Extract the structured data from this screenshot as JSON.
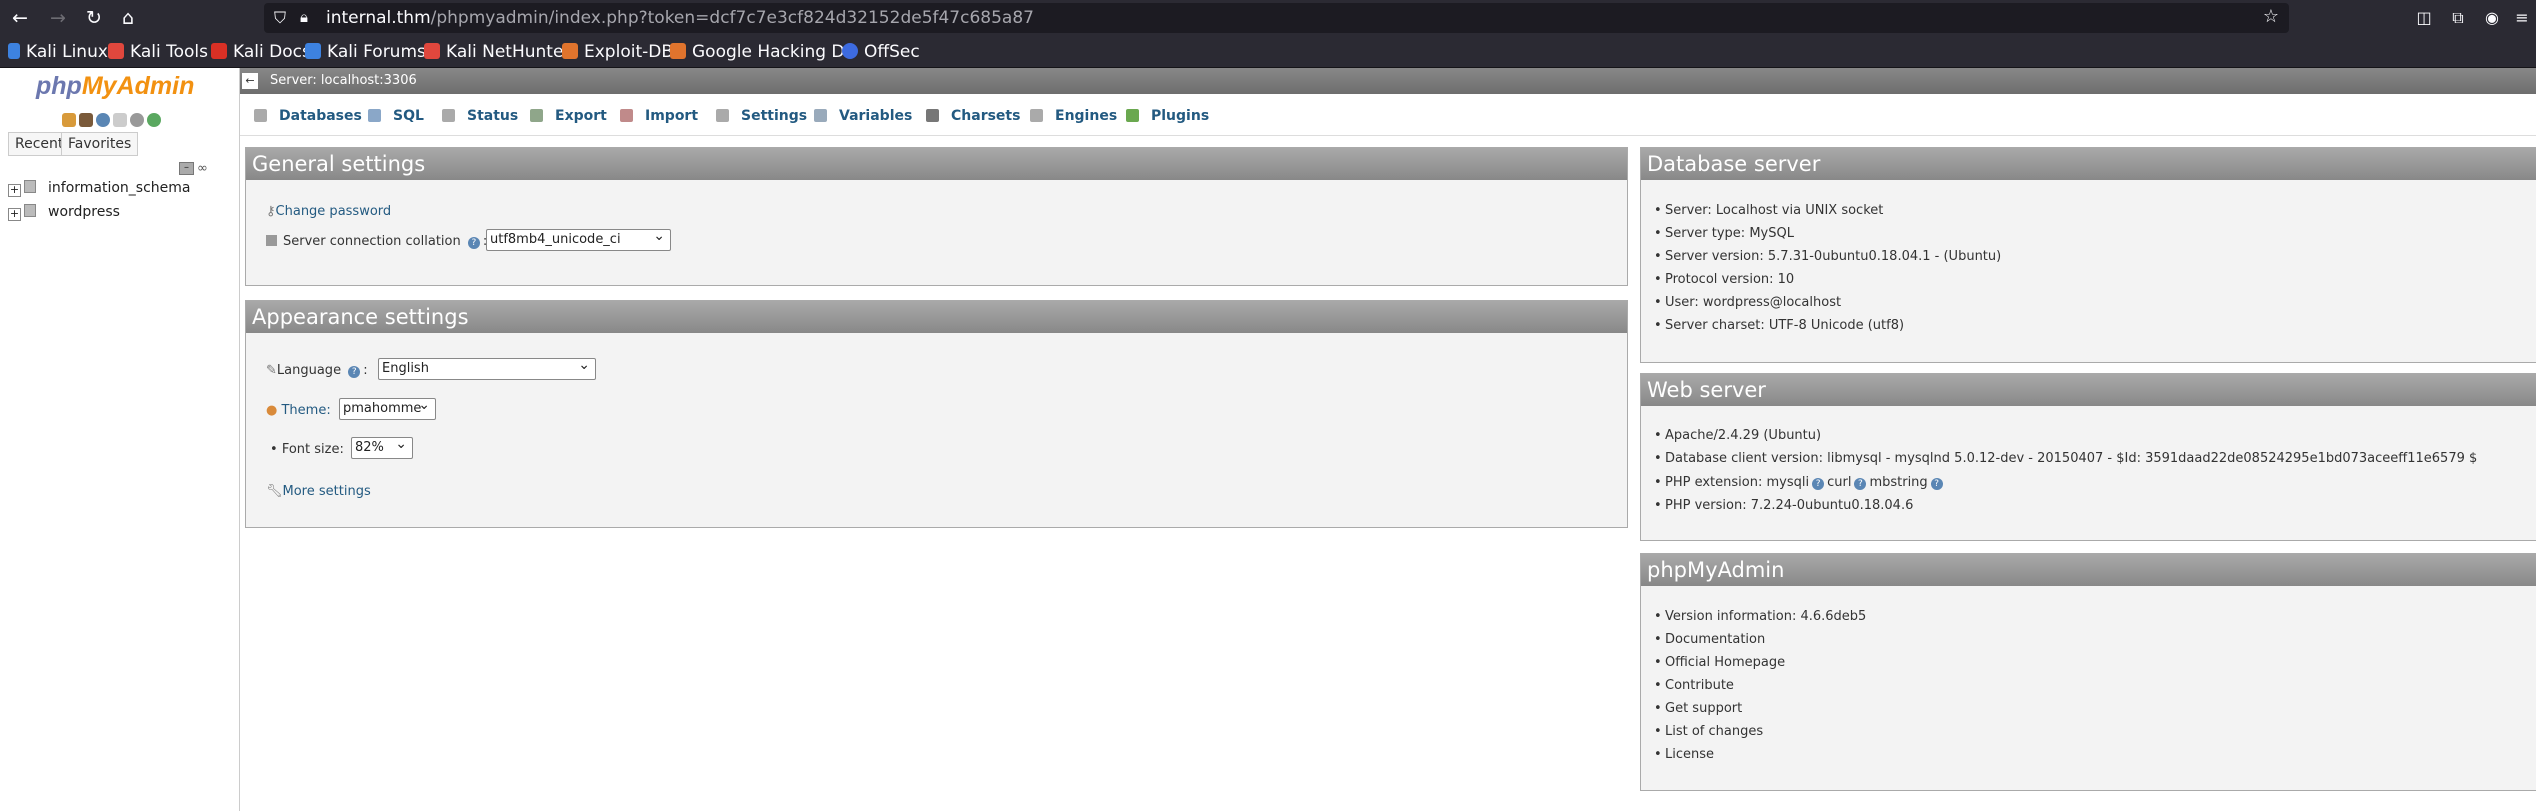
{
  "browser": {
    "url_host": "internal.thm",
    "url_path": "/phpmyadmin/index.php?token=dcf7c7e3cf824d32152de5f47c685a87",
    "bookmarks": [
      "Kali Linux",
      "Kali Tools",
      "Kali Docs",
      "Kali Forums",
      "Kali NetHunter",
      "Exploit-DB",
      "Google Hacking DB",
      "OffSec"
    ]
  },
  "nav": {
    "logo_php": "php",
    "logo_my": "My",
    "logo_admin": "Admin",
    "tab_recent": "Recent",
    "tab_favorites": "Favorites",
    "databases": [
      "information_schema",
      "wordpress"
    ]
  },
  "server_strip": "Server: localhost:3306",
  "menu_tabs": [
    "Databases",
    "SQL",
    "Status",
    "Export",
    "Import",
    "Settings",
    "Variables",
    "Charsets",
    "Engines",
    "Plugins"
  ],
  "general": {
    "title": "General settings",
    "change_password": "Change password",
    "collation_label": "Server connection collation",
    "collation_value": "utf8mb4_unicode_ci"
  },
  "appearance": {
    "title": "Appearance settings",
    "language_label": "Language",
    "language_value": "English",
    "theme_label": "Theme:",
    "theme_value": "pmahomme",
    "font_label": "Font size:",
    "font_value": "82%",
    "more_settings": "More settings"
  },
  "db_server": {
    "title": "Database server",
    "items": [
      "Server: Localhost via UNIX socket",
      "Server type: MySQL",
      "Server version: 5.7.31-0ubuntu0.18.04.1 - (Ubuntu)",
      "Protocol version: 10",
      "User: wordpress@localhost",
      "Server charset: UTF-8 Unicode (utf8)"
    ]
  },
  "web_server": {
    "title": "Web server",
    "apache": "Apache/2.4.29 (Ubuntu)",
    "client": "Database client version: libmysql - mysqlnd 5.0.12-dev - 20150407 - $Id: 3591daad22de08524295e1bd073aceeff11e6579 $",
    "php_ext_label": "PHP extension: mysqli",
    "php_ext_curl": "curl",
    "php_ext_mb": "mbstring",
    "php_version": "PHP version: 7.2.24-0ubuntu0.18.04.6"
  },
  "pma": {
    "title": "phpMyAdmin",
    "version": "Version information: 4.6.6deb5",
    "links": [
      "Documentation",
      "Official Homepage",
      "Contribute",
      "Get support",
      "List of changes",
      "License"
    ]
  }
}
